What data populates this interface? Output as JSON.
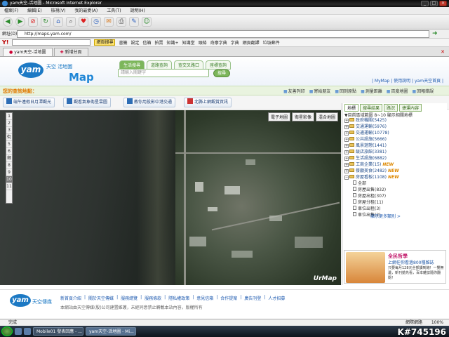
{
  "window": {
    "title": "yam天空-活地圖 - Microsoft Internet Explorer",
    "min": "_",
    "max": "□",
    "close": "✕"
  },
  "menu": [
    "檔案(F)",
    "編輯(E)",
    "檢視(V)",
    "我的最愛(A)",
    "工具(T)",
    "說明(H)"
  ],
  "toolbar_icons": [
    "back-icon",
    "forward-icon",
    "stop-icon",
    "refresh-icon",
    "home-icon",
    "search-icon",
    "favorites-icon",
    "history-icon",
    "mail-icon",
    "print-icon",
    "edit-icon",
    "messenger-icon"
  ],
  "address": {
    "label": "網址(D)",
    "value": "http://maps.yam.com/"
  },
  "yahoo": {
    "logo": "Y!",
    "buttons": [
      "網頁搜尋",
      "書籤",
      "設定",
      "信箱",
      "拍賣",
      "知識+",
      "知識堂",
      "頭條",
      "奇摩字典",
      "字典",
      "網頁翻譯",
      "垃圾郵件"
    ]
  },
  "tabs": [
    {
      "label": "yam天空-活地圖",
      "active": true
    },
    {
      "label": "新增分頁",
      "active": false
    }
  ],
  "site": {
    "logo_yam": "yam",
    "logo_zh": "天空 活地圖",
    "logo_map": "Map",
    "search_tabs": [
      "生活搜尋",
      "道路查詢",
      "查交叉路口",
      "座標查詢"
    ],
    "search_placeholder": "請輸入關鍵字",
    "search_button": "搜尋",
    "top_links": "| MyMap | 使用說明 | yam天空首頁 |"
  },
  "subnav": {
    "location_label": "您的查詢地點：",
    "tools": [
      "友善列印",
      "寄給朋友",
      "回到原點",
      "測量距離",
      "百度地圖",
      "回報錯誤"
    ]
  },
  "quick_links": [
    "端午連假日月潭觀光",
    "觀看氣象衛星雲圖",
    "教你用投影中港交通",
    "北縣上網觀賞資訊"
  ],
  "map": {
    "zoom_levels": [
      "1",
      "2",
      "3",
      "街",
      "5",
      "6",
      "鄉",
      "8",
      "9",
      "10",
      "11"
    ],
    "selected_zoom": "10",
    "map_types": [
      "電子地圖",
      "衛星影像",
      "混合地圖"
    ],
    "brand": "UrMap"
  },
  "sidebar": {
    "tabs": [
      "地標",
      "搜尋結果",
      "路況",
      "捷運內容"
    ],
    "header": "▼目前區域範圍 8~10 顯示相關地標",
    "categories": [
      {
        "label": "政府機關(5425)",
        "new": false
      },
      {
        "label": "交通運輸(5976)",
        "new": false
      },
      {
        "label": "交通運輸(10778)",
        "new": false
      },
      {
        "label": "公共設施(5666)",
        "new": false
      },
      {
        "label": "風景遊憩(1441)",
        "new": false
      },
      {
        "label": "飯店旅館(3381)",
        "new": false
      },
      {
        "label": "生活設施(6882)",
        "new": false
      },
      {
        "label": "工商企業(15)",
        "new": true
      },
      {
        "label": "餐廳美食(2482)",
        "new": true
      },
      {
        "label": "房屋看板(1108)",
        "new": true
      }
    ],
    "subcategories": [
      "全部",
      "房屋出售(832)",
      "房屋出租(307)",
      "房屋分租(11)",
      "車位出租(3)",
      "車位出售(2)"
    ],
    "more_link": "顯示更多類別 >",
    "ad": {
      "title": "全民哲學",
      "line1": "上網任你看過800種雜誌",
      "line2": "只要每月128元全部讀到飽！一覽無遺，新刊搶先看，百本雜誌隨你翻閱！"
    }
  },
  "footer": {
    "logo": "yam",
    "logo_text": "天空傳媒",
    "links": [
      "新首頁介紹",
      "關於天空傳媒",
      "服務總覽",
      "服務條款",
      "隱私權政策",
      "意見信箱",
      "合作提案",
      "廣告刊登",
      "人才招募"
    ],
    "copyright": "本網站由天空傳媒(股)公司建置維護，未經同意禁止轉載本站內容，版權所有"
  },
  "status": {
    "left": "完成",
    "right": "網際網路",
    "zoom": "100%"
  },
  "taskbar": {
    "tasks": [
      {
        "label": "Mobile01 發表回應 - ...",
        "active": false
      },
      {
        "label": "yam天空-活地圖 - Mi...",
        "active": true
      }
    ]
  },
  "watermark": "K#745196"
}
